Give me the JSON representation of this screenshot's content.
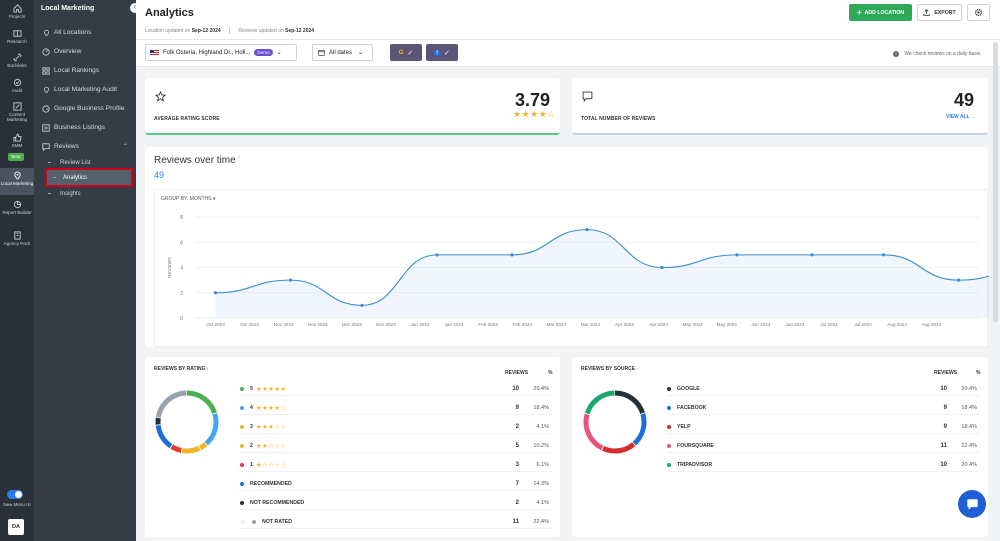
{
  "rail": {
    "items": [
      {
        "label": "Projects",
        "icon": "home-icon"
      },
      {
        "label": "Research",
        "icon": "book-icon"
      },
      {
        "label": "Backlinks",
        "icon": "link-icon"
      },
      {
        "label": "Audit",
        "icon": "audit-icon"
      },
      {
        "label": "Content Marketing",
        "icon": "edit-icon"
      },
      {
        "label": "SMM",
        "icon": "thumbs-up-icon"
      },
      {
        "label": "Local Marketing",
        "icon": "map-pin-icon"
      },
      {
        "label": "Report Builder",
        "icon": "report-icon"
      },
      {
        "label": "Agency Pack",
        "icon": "building-icon"
      }
    ],
    "beta_badge": "Beta",
    "new_menu_label": "New Menu UI",
    "avatar_initials": "DA"
  },
  "sidebar": {
    "title": "Local Marketing",
    "items": [
      {
        "label": "All Locations"
      },
      {
        "label": "Overview"
      },
      {
        "label": "Local Rankings"
      },
      {
        "label": "Local Marketing Audit"
      },
      {
        "label": "Google Business Profile"
      },
      {
        "label": "Business Listings"
      },
      {
        "label": "Reviews"
      }
    ],
    "sub_items": [
      {
        "label": "Review List"
      },
      {
        "label": "Analytics"
      },
      {
        "label": "Insights"
      }
    ]
  },
  "header": {
    "title": "Analytics",
    "location_updated_label": "Location updated on",
    "location_updated_date": "Sep-12 2024",
    "reviews_updated_label": "Reviews updated on",
    "reviews_updated_date": "Sep-12 2024",
    "add_location": "ADD LOCATION",
    "export": "EXPORT"
  },
  "filters": {
    "location": "Folk Osteria, Highland Dr., Holl...",
    "demo_badge": "Demo",
    "dates": "All dates",
    "daily_note": "We check reviews on a daily basis"
  },
  "metrics": {
    "avg_label": "AVERAGE RATING SCORE",
    "avg_value": "3.79",
    "avg_stars": "★★★★☆",
    "total_label": "TOTAL NUMBER OF REVIEWS",
    "total_value": "49",
    "view_all": "VIEW ALL"
  },
  "over_time": {
    "title": "Reviews over time",
    "count": "49",
    "group_by": "GROUP BY: MONTHS"
  },
  "chart_data": {
    "type": "line",
    "ylabel": "REVIEWS",
    "ylim": [
      0,
      8
    ],
    "yticks": [
      "0",
      "2",
      "4",
      "6",
      "8"
    ],
    "x": [
      "Oct 2023",
      "Oct 2023",
      "Nov 2023",
      "Nov 2023",
      "Dec 2023",
      "Dec 2023",
      "Jan 2024",
      "Jan 2024",
      "Feb 2024",
      "Feb 2024",
      "Mar 2024",
      "Mar 2024",
      "Apr 2024",
      "Apr 2024",
      "May 2024",
      "May 2024",
      "Jun 2024",
      "Jun 2024",
      "Jul 2024",
      "Jul 2024",
      "Aug 2024",
      "Aug 2024"
    ],
    "points": [
      {
        "x": 0,
        "y": 2
      },
      {
        "x": 2.2,
        "y": 3
      },
      {
        "x": 4.3,
        "y": 1
      },
      {
        "x": 6.5,
        "y": 5
      },
      {
        "x": 8.7,
        "y": 5
      },
      {
        "x": 10.9,
        "y": 7
      },
      {
        "x": 13.1,
        "y": 4
      },
      {
        "x": 15.3,
        "y": 5
      },
      {
        "x": 17.5,
        "y": 5
      },
      {
        "x": 19.6,
        "y": 5
      },
      {
        "x": 21.8,
        "y": 3
      },
      {
        "x": 24.0,
        "y": 4
      }
    ],
    "color": "#3d8ed6"
  },
  "by_rating": {
    "title": "REVIEWS BY RATING",
    "col_reviews": "REVIEWS",
    "col_pct": "%",
    "rows": [
      {
        "label": "5",
        "stars": "★★★★★",
        "count": "10",
        "pct": "20.4%",
        "color": "#4caf50"
      },
      {
        "label": "4",
        "stars": "★★★★☆",
        "count": "9",
        "pct": "18.4%",
        "color": "#42a5f5"
      },
      {
        "label": "3",
        "stars": "★★★☆☆",
        "count": "2",
        "pct": "4.1%",
        "color": "#f0b42b"
      },
      {
        "label": "2",
        "stars": "★★☆☆☆",
        "count": "5",
        "pct": "10.2%",
        "color": "#f0b42b"
      },
      {
        "label": "1",
        "stars": "★☆☆☆☆",
        "count": "3",
        "pct": "6.1%",
        "color": "#e53935"
      },
      {
        "label": "RECOMMENDED",
        "stars": "",
        "count": "7",
        "pct": "14.3%",
        "color": "#1e6fd9"
      },
      {
        "label": "NOT RECOMMENDED",
        "stars": "",
        "count": "2",
        "pct": "4.1%",
        "color": "#263238"
      },
      {
        "label": "NOT RATED",
        "stars": "☆",
        "count": "11",
        "pct": "22.4%",
        "color": "#9aa1ab"
      }
    ]
  },
  "by_source": {
    "title": "REVIEWS BY SOURCE",
    "col_reviews": "REVIEWS",
    "col_pct": "%",
    "rows": [
      {
        "label": "GOOGLE",
        "count": "10",
        "pct": "20.4%",
        "color": "#263238"
      },
      {
        "label": "FACEBOOK",
        "count": "9",
        "pct": "18.4%",
        "color": "#1e6fd9"
      },
      {
        "label": "YELP",
        "count": "9",
        "pct": "18.4%",
        "color": "#d32f2f"
      },
      {
        "label": "FOURSQUARE",
        "count": "11",
        "pct": "22.4%",
        "color": "#e8547a"
      },
      {
        "label": "TRIPADVISOR",
        "count": "10",
        "pct": "20.4%",
        "color": "#18a86b"
      }
    ]
  }
}
